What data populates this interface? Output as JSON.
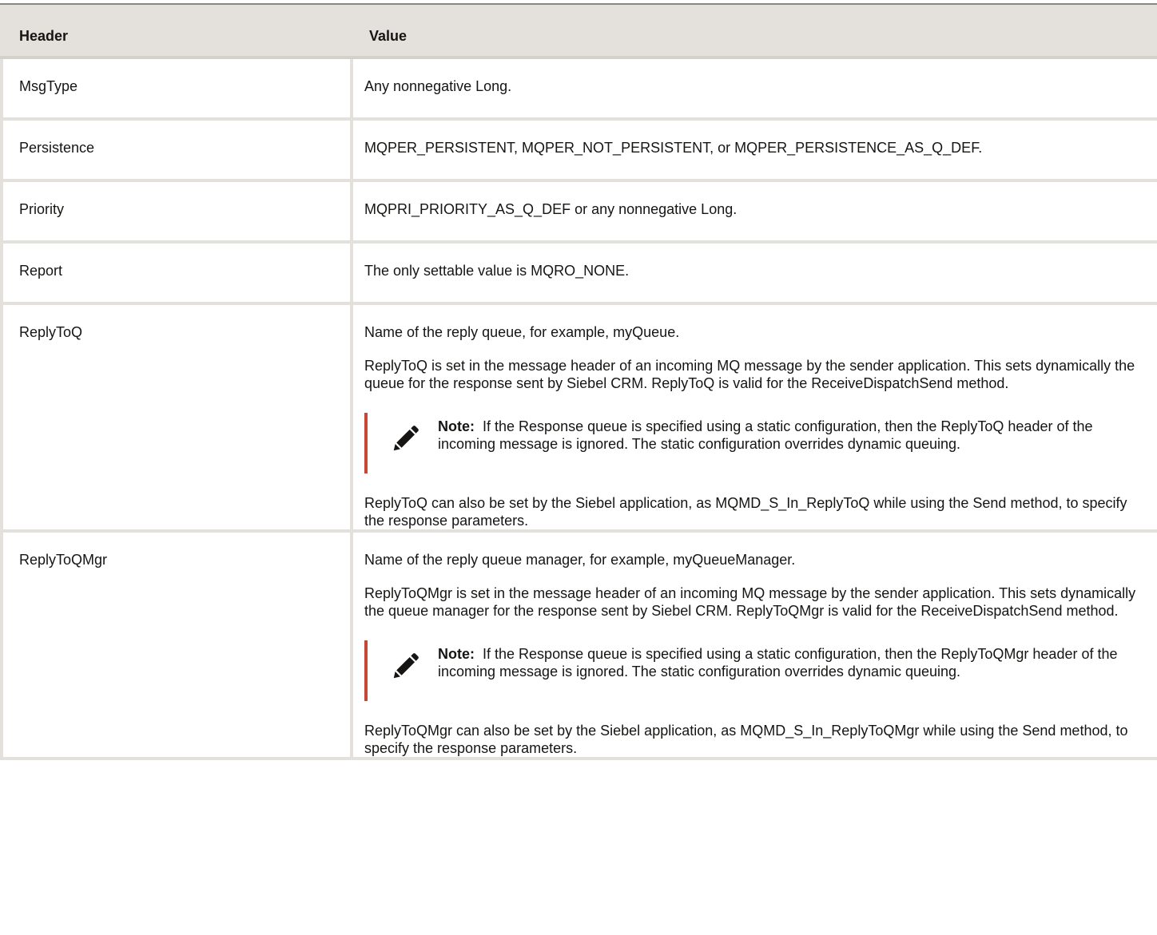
{
  "table": {
    "header_col1": "Header",
    "header_col2": "Value",
    "rows": [
      {
        "name": "MsgType",
        "value": "Any nonnegative Long."
      },
      {
        "name": "Persistence",
        "value": "MQPER_PERSISTENT, MQPER_NOT_PERSISTENT, or MQPER_PERSISTENCE_AS_Q_DEF."
      },
      {
        "name": "Priority",
        "value": "MQPRI_PRIORITY_AS_Q_DEF or any nonnegative Long."
      },
      {
        "name": "Report",
        "value": "The only settable value is MQRO_NONE."
      },
      {
        "name": "ReplyToQ",
        "p1": "Name of the reply queue, for example, myQueue.",
        "p2": "ReplyToQ is set in the message header of an incoming MQ message by the sender application. This sets dynamically the queue for the response sent by Siebel CRM. ReplyToQ is valid for the ReceiveDispatchSend method.",
        "note_label": "Note:",
        "note_text": "If the Response queue is specified using a static configuration, then the ReplyToQ header of the incoming message is ignored. The static configuration overrides dynamic queuing.",
        "p3": "ReplyToQ can also be set by the Siebel application, as MQMD_S_In_ReplyToQ while using the Send method, to specify the response parameters."
      },
      {
        "name": "ReplyToQMgr",
        "p1": "Name of the reply queue manager, for example, myQueueManager.",
        "p2": "ReplyToQMgr is set in the message header of an incoming MQ message by the sender application. This sets dynamically the queue manager for the response sent by Siebel CRM. ReplyToQMgr is valid for the ReceiveDispatchSend method.",
        "note_label": "Note:",
        "note_text": "If the Response queue is specified using a static configuration, then the ReplyToQMgr header of the incoming message is ignored. The static configuration overrides dynamic queuing.",
        "p3": "ReplyToQMgr can also be set by the Siebel application, as MQMD_S_In_ReplyToQMgr while using the Send method, to specify the response parameters."
      }
    ]
  },
  "icons": {
    "note_icon": "pencil-icon"
  },
  "colors": {
    "note_border": "#c74634",
    "header_bg": "#e4e1dc",
    "grid": "#e4e1dc",
    "text": "#161513"
  }
}
